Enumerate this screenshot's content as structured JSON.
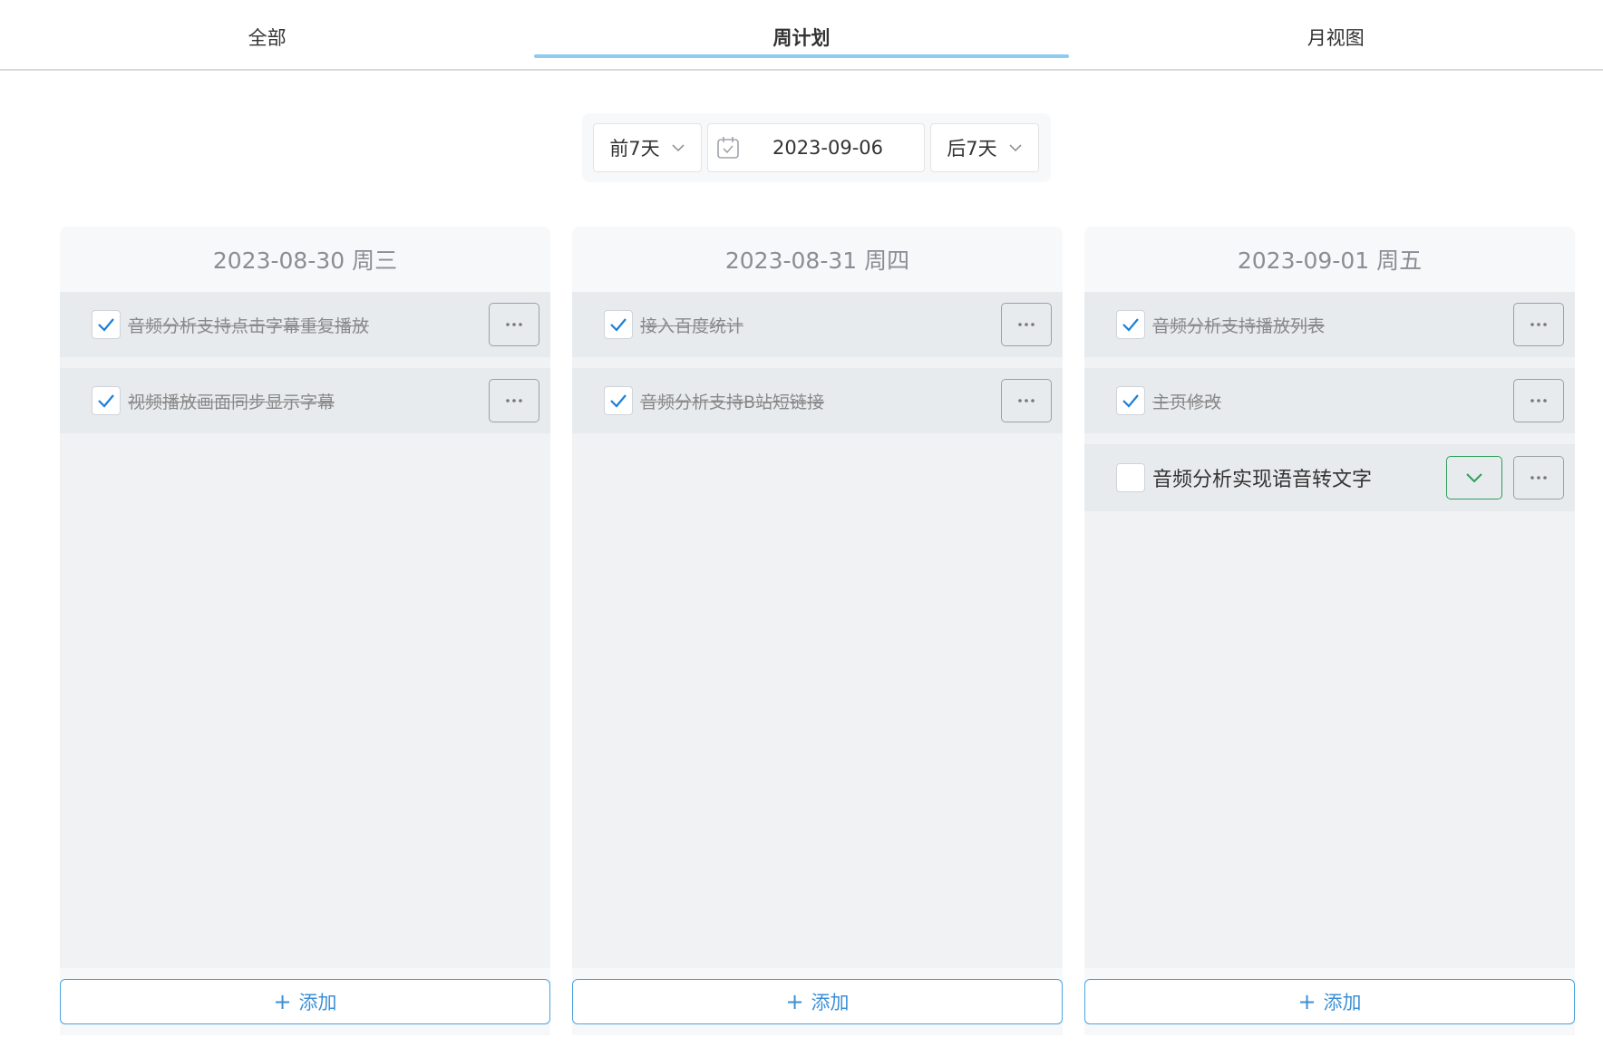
{
  "tabs": [
    {
      "label": "全部",
      "active": false
    },
    {
      "label": "周计划",
      "active": true
    },
    {
      "label": "月视图",
      "active": false
    }
  ],
  "toolbar": {
    "prev_label": "前7天",
    "date_value": "2023-09-06",
    "next_label": "后7天"
  },
  "columns": [
    {
      "title": "2023-08-30 周三",
      "tasks": [
        {
          "text": "音频分析支持点击字幕重复播放",
          "done": true
        },
        {
          "text": "视频播放画面同步显示字幕",
          "done": true
        }
      ],
      "add_label": "添加"
    },
    {
      "title": "2023-08-31 周四",
      "tasks": [
        {
          "text": "接入百度统计",
          "done": true
        },
        {
          "text": "音频分析支持B站短链接",
          "done": true
        }
      ],
      "add_label": "添加"
    },
    {
      "title": "2023-09-01 周五",
      "tasks": [
        {
          "text": "音频分析支持播放列表",
          "done": true
        },
        {
          "text": "主页修改",
          "done": true
        },
        {
          "text": "音频分析实现语音转文字",
          "done": false
        }
      ],
      "add_label": "添加"
    }
  ],
  "colors": {
    "accent": "#3b8fd6",
    "tab_indicator": "#8ecbef",
    "check": "#1a7fd6",
    "complete_action": "#2e9e5a"
  }
}
